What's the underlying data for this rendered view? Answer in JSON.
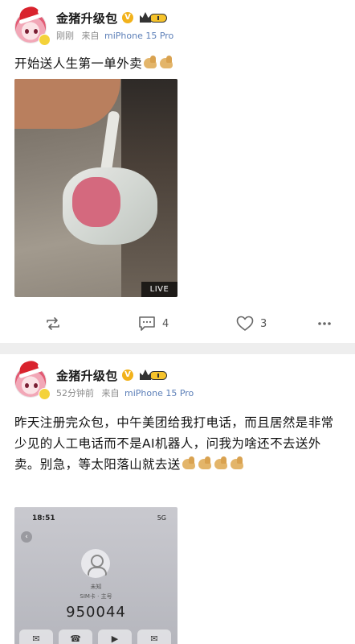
{
  "posts": [
    {
      "author": "金猪升级包",
      "verified_mark": "V",
      "time": "刚刚",
      "source_prefix": "来自",
      "device": "miPhone 15 Pro",
      "text": "开始送人生第一单外卖",
      "media_badge": "LIVE",
      "actions": {
        "repost_count": "",
        "comment_count": "4",
        "like_count": "3"
      }
    },
    {
      "author": "金猪升级包",
      "verified_mark": "V",
      "time": "52分钟前",
      "source_prefix": "来自",
      "device": "miPhone 15 Pro",
      "text": "昨天注册完众包，中午美团给我打电话，而且居然是非常少见的人工电话而不是AI机器人，问我为啥还不去送外卖。别急，等太阳落山就去送",
      "screenshot": {
        "status_time": "18:51",
        "status_right": "5G",
        "caller_line1": "未知",
        "caller_line2": "SIM卡 · 主号",
        "phone_number": "950044"
      }
    }
  ],
  "icons": {
    "repost": "repost-icon",
    "comment": "comment-icon",
    "like": "like-icon",
    "more": "more-icon",
    "emoji": "flexed-biceps-emoji"
  },
  "colors": {
    "device_link": "#5c7fb8",
    "verified_badge": "#f2b21b",
    "separator": "#eeeeee"
  }
}
